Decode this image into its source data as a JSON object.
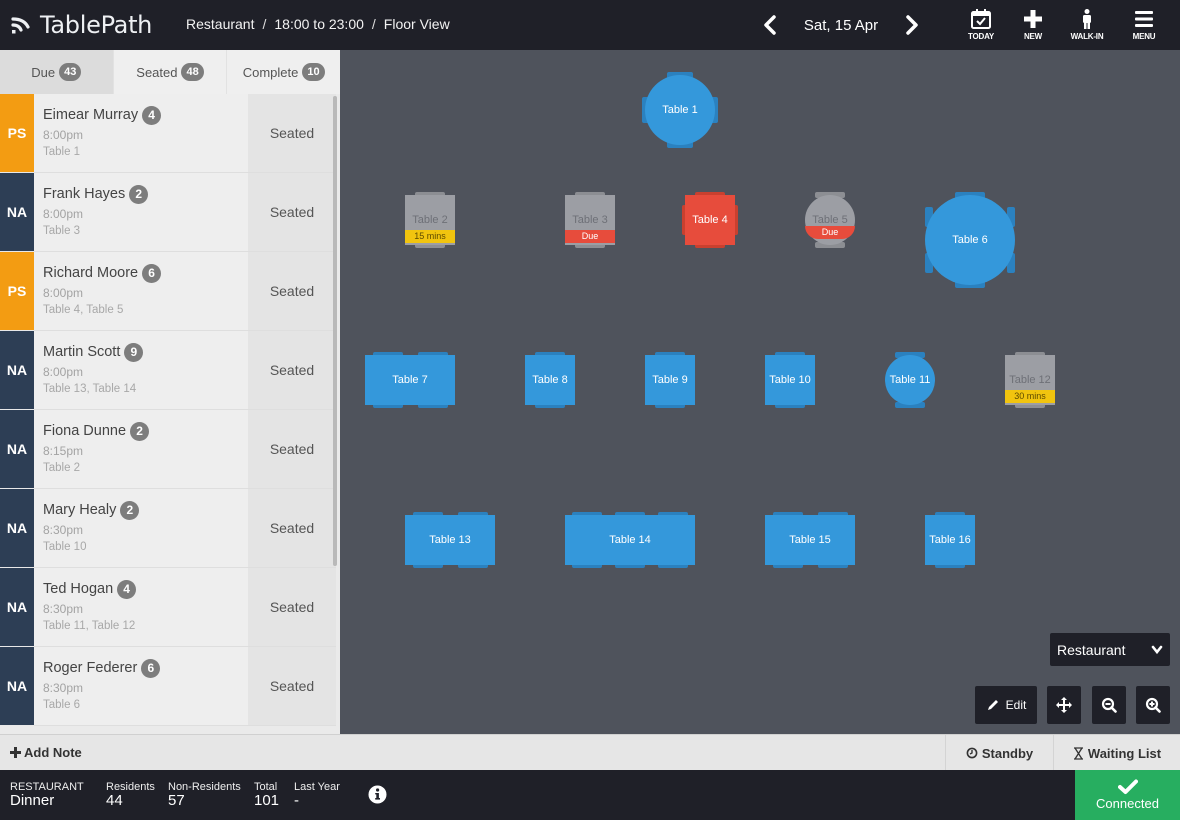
{
  "header": {
    "app_name": "TablePath",
    "breadcrumb": [
      "Restaurant",
      "18:00 to 23:00",
      "Floor View"
    ],
    "breadcrumb_separator": "/",
    "date": "Sat, 15 Apr",
    "tools": [
      {
        "label": "TODAY",
        "icon": "calendar-check-icon"
      },
      {
        "label": "NEW",
        "icon": "plus-icon"
      },
      {
        "label": "WALK-IN",
        "icon": "person-icon"
      },
      {
        "label": "MENU",
        "icon": "hamburger-icon"
      }
    ]
  },
  "tabs": [
    {
      "label": "Due",
      "count": "43",
      "active": true
    },
    {
      "label": "Seated",
      "count": "48",
      "active": false
    },
    {
      "label": "Complete",
      "count": "10",
      "active": false
    }
  ],
  "bookings": [
    {
      "source": "PS",
      "name": "Eimear Murray",
      "covers": "4",
      "time": "8:00pm",
      "tables": "Table 1",
      "status": "Seated"
    },
    {
      "source": "NA",
      "name": "Frank Hayes",
      "covers": "2",
      "time": "8:00pm",
      "tables": "Table 3",
      "status": "Seated"
    },
    {
      "source": "PS",
      "name": "Richard Moore",
      "covers": "6",
      "time": "8:00pm",
      "tables": "Table 4, Table 5",
      "status": "Seated"
    },
    {
      "source": "NA",
      "name": "Martin Scott",
      "covers": "9",
      "time": "8:00pm",
      "tables": "Table 13, Table 14",
      "status": "Seated"
    },
    {
      "source": "NA",
      "name": "Fiona Dunne",
      "covers": "2",
      "time": "8:15pm",
      "tables": "Table 2",
      "status": "Seated"
    },
    {
      "source": "NA",
      "name": "Mary Healy",
      "covers": "2",
      "time": "8:30pm",
      "tables": "Table 10",
      "status": "Seated"
    },
    {
      "source": "NA",
      "name": "Ted Hogan",
      "covers": "4",
      "time": "8:30pm",
      "tables": "Table 11, Table 12",
      "status": "Seated"
    },
    {
      "source": "NA",
      "name": "Roger Federer",
      "covers": "6",
      "time": "8:30pm",
      "tables": "Table 6",
      "status": "Seated"
    }
  ],
  "floor": {
    "tables": [
      {
        "label": "Table 1",
        "state": "seated",
        "tag": null
      },
      {
        "label": "Table 2",
        "state": "empty",
        "tag": "15 mins",
        "tag_type": "warning"
      },
      {
        "label": "Table 3",
        "state": "empty",
        "tag": "Due",
        "tag_type": "due"
      },
      {
        "label": "Table 4",
        "state": "due",
        "tag": null
      },
      {
        "label": "Table 5",
        "state": "empty",
        "tag": "Due",
        "tag_type": "due"
      },
      {
        "label": "Table 6",
        "state": "seated",
        "tag": null
      },
      {
        "label": "Table 7",
        "state": "seated",
        "tag": null
      },
      {
        "label": "Table 8",
        "state": "seated",
        "tag": null
      },
      {
        "label": "Table 9",
        "state": "seated",
        "tag": null
      },
      {
        "label": "Table 10",
        "state": "seated",
        "tag": null
      },
      {
        "label": "Table 11",
        "state": "seated",
        "tag": null
      },
      {
        "label": "Table 12",
        "state": "empty",
        "tag": "30 mins",
        "tag_type": "warning"
      },
      {
        "label": "Table 13",
        "state": "seated",
        "tag": null
      },
      {
        "label": "Table 14",
        "state": "seated",
        "tag": null
      },
      {
        "label": "Table 15",
        "state": "seated",
        "tag": null
      },
      {
        "label": "Table 16",
        "state": "seated",
        "tag": null
      }
    ],
    "area_select": "Restaurant",
    "edit_label": "Edit"
  },
  "notebar": {
    "add_note": "Add Note",
    "standby": "Standby",
    "waiting_list": "Waiting List"
  },
  "footer": {
    "section_label": "RESTAURANT",
    "section_value": "Dinner",
    "stats": [
      {
        "label": "Residents",
        "value": "44"
      },
      {
        "label": "Non-Residents",
        "value": "57"
      },
      {
        "label": "Total",
        "value": "101"
      },
      {
        "label": "Last Year",
        "value": "-"
      }
    ],
    "connection": "Connected"
  },
  "colors": {
    "seated": "#3498db",
    "due": "#e74c3c",
    "empty": "#9c9ea4",
    "warning": "#f1c40f",
    "source_ps": "#f39c12",
    "source_na": "#2d3e55",
    "connected": "#27ae60"
  }
}
